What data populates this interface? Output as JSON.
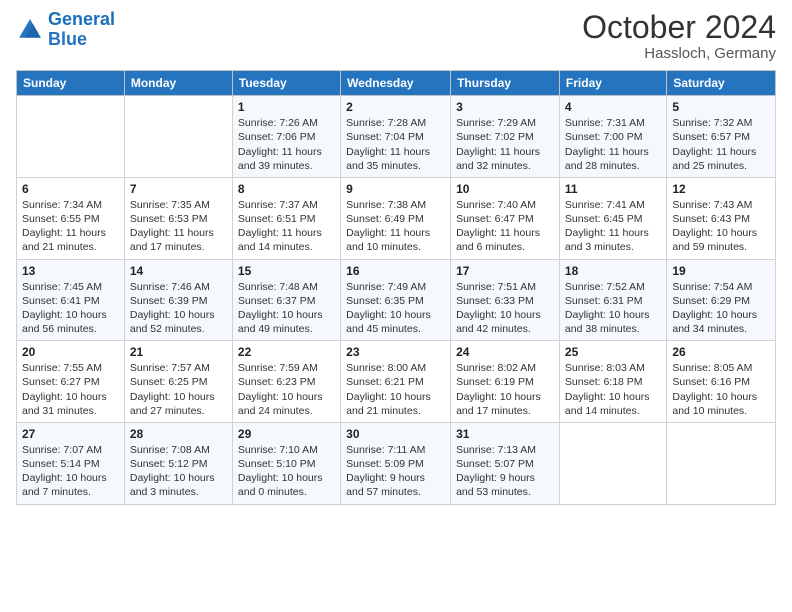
{
  "logo": {
    "line1": "General",
    "line2": "Blue"
  },
  "header": {
    "month": "October 2024",
    "location": "Hassloch, Germany"
  },
  "weekdays": [
    "Sunday",
    "Monday",
    "Tuesday",
    "Wednesday",
    "Thursday",
    "Friday",
    "Saturday"
  ],
  "rows": [
    [
      {
        "day": "",
        "info": ""
      },
      {
        "day": "",
        "info": ""
      },
      {
        "day": "1",
        "info": "Sunrise: 7:26 AM\nSunset: 7:06 PM\nDaylight: 11 hours and 39 minutes."
      },
      {
        "day": "2",
        "info": "Sunrise: 7:28 AM\nSunset: 7:04 PM\nDaylight: 11 hours and 35 minutes."
      },
      {
        "day": "3",
        "info": "Sunrise: 7:29 AM\nSunset: 7:02 PM\nDaylight: 11 hours and 32 minutes."
      },
      {
        "day": "4",
        "info": "Sunrise: 7:31 AM\nSunset: 7:00 PM\nDaylight: 11 hours and 28 minutes."
      },
      {
        "day": "5",
        "info": "Sunrise: 7:32 AM\nSunset: 6:57 PM\nDaylight: 11 hours and 25 minutes."
      }
    ],
    [
      {
        "day": "6",
        "info": "Sunrise: 7:34 AM\nSunset: 6:55 PM\nDaylight: 11 hours and 21 minutes."
      },
      {
        "day": "7",
        "info": "Sunrise: 7:35 AM\nSunset: 6:53 PM\nDaylight: 11 hours and 17 minutes."
      },
      {
        "day": "8",
        "info": "Sunrise: 7:37 AM\nSunset: 6:51 PM\nDaylight: 11 hours and 14 minutes."
      },
      {
        "day": "9",
        "info": "Sunrise: 7:38 AM\nSunset: 6:49 PM\nDaylight: 11 hours and 10 minutes."
      },
      {
        "day": "10",
        "info": "Sunrise: 7:40 AM\nSunset: 6:47 PM\nDaylight: 11 hours and 6 minutes."
      },
      {
        "day": "11",
        "info": "Sunrise: 7:41 AM\nSunset: 6:45 PM\nDaylight: 11 hours and 3 minutes."
      },
      {
        "day": "12",
        "info": "Sunrise: 7:43 AM\nSunset: 6:43 PM\nDaylight: 10 hours and 59 minutes."
      }
    ],
    [
      {
        "day": "13",
        "info": "Sunrise: 7:45 AM\nSunset: 6:41 PM\nDaylight: 10 hours and 56 minutes."
      },
      {
        "day": "14",
        "info": "Sunrise: 7:46 AM\nSunset: 6:39 PM\nDaylight: 10 hours and 52 minutes."
      },
      {
        "day": "15",
        "info": "Sunrise: 7:48 AM\nSunset: 6:37 PM\nDaylight: 10 hours and 49 minutes."
      },
      {
        "day": "16",
        "info": "Sunrise: 7:49 AM\nSunset: 6:35 PM\nDaylight: 10 hours and 45 minutes."
      },
      {
        "day": "17",
        "info": "Sunrise: 7:51 AM\nSunset: 6:33 PM\nDaylight: 10 hours and 42 minutes."
      },
      {
        "day": "18",
        "info": "Sunrise: 7:52 AM\nSunset: 6:31 PM\nDaylight: 10 hours and 38 minutes."
      },
      {
        "day": "19",
        "info": "Sunrise: 7:54 AM\nSunset: 6:29 PM\nDaylight: 10 hours and 34 minutes."
      }
    ],
    [
      {
        "day": "20",
        "info": "Sunrise: 7:55 AM\nSunset: 6:27 PM\nDaylight: 10 hours and 31 minutes."
      },
      {
        "day": "21",
        "info": "Sunrise: 7:57 AM\nSunset: 6:25 PM\nDaylight: 10 hours and 27 minutes."
      },
      {
        "day": "22",
        "info": "Sunrise: 7:59 AM\nSunset: 6:23 PM\nDaylight: 10 hours and 24 minutes."
      },
      {
        "day": "23",
        "info": "Sunrise: 8:00 AM\nSunset: 6:21 PM\nDaylight: 10 hours and 21 minutes."
      },
      {
        "day": "24",
        "info": "Sunrise: 8:02 AM\nSunset: 6:19 PM\nDaylight: 10 hours and 17 minutes."
      },
      {
        "day": "25",
        "info": "Sunrise: 8:03 AM\nSunset: 6:18 PM\nDaylight: 10 hours and 14 minutes."
      },
      {
        "day": "26",
        "info": "Sunrise: 8:05 AM\nSunset: 6:16 PM\nDaylight: 10 hours and 10 minutes."
      }
    ],
    [
      {
        "day": "27",
        "info": "Sunrise: 7:07 AM\nSunset: 5:14 PM\nDaylight: 10 hours and 7 minutes."
      },
      {
        "day": "28",
        "info": "Sunrise: 7:08 AM\nSunset: 5:12 PM\nDaylight: 10 hours and 3 minutes."
      },
      {
        "day": "29",
        "info": "Sunrise: 7:10 AM\nSunset: 5:10 PM\nDaylight: 10 hours and 0 minutes."
      },
      {
        "day": "30",
        "info": "Sunrise: 7:11 AM\nSunset: 5:09 PM\nDaylight: 9 hours and 57 minutes."
      },
      {
        "day": "31",
        "info": "Sunrise: 7:13 AM\nSunset: 5:07 PM\nDaylight: 9 hours and 53 minutes."
      },
      {
        "day": "",
        "info": ""
      },
      {
        "day": "",
        "info": ""
      }
    ]
  ]
}
